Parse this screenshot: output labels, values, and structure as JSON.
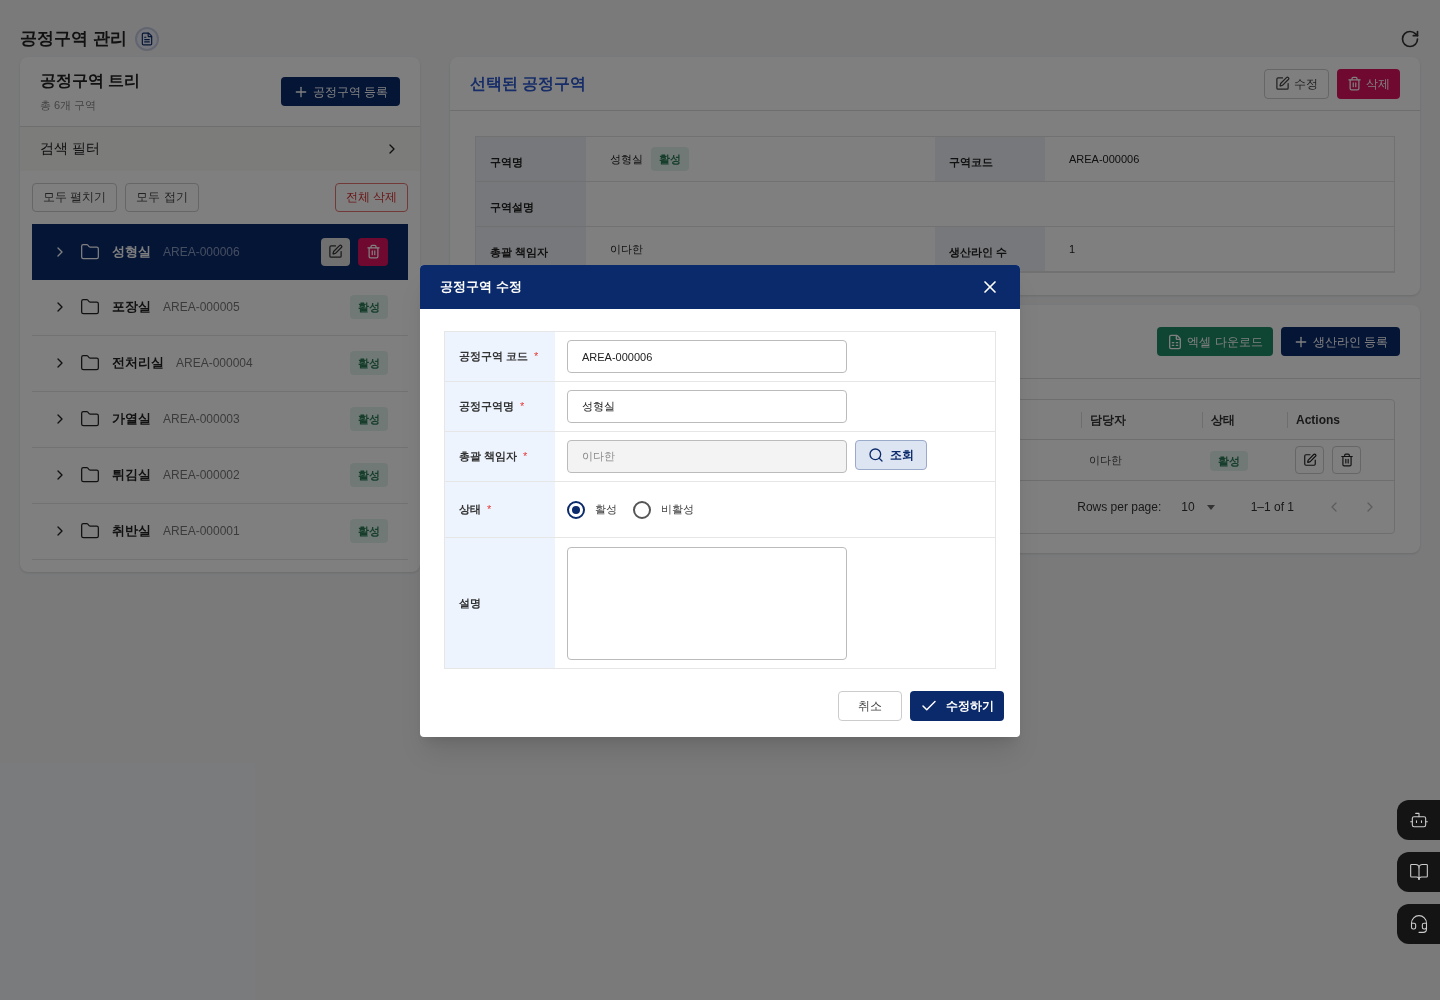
{
  "page": {
    "title": "공정구역 관리"
  },
  "tree_panel": {
    "title": "공정구역 트리",
    "count": "총 6개 구역",
    "register_button": "공정구역 등록",
    "filter_label": "검색 필터",
    "expand_all": "모두 펼치기",
    "collapse_all": "모두 접기",
    "delete_all": "전체 삭제",
    "items": [
      {
        "name": "성형실",
        "code": "AREA-000006",
        "selected": true
      },
      {
        "name": "포장실",
        "code": "AREA-000005",
        "status": "활성",
        "selected": false
      },
      {
        "name": "전처리실",
        "code": "AREA-000004",
        "status": "활성",
        "selected": false
      },
      {
        "name": "가열실",
        "code": "AREA-000003",
        "status": "활성",
        "selected": false
      },
      {
        "name": "튀김실",
        "code": "AREA-000002",
        "status": "활성",
        "selected": false
      },
      {
        "name": "취반실",
        "code": "AREA-000001",
        "status": "활성",
        "selected": false
      }
    ]
  },
  "detail_panel": {
    "title": "선택된 공정구역",
    "edit_button": "수정",
    "delete_button": "삭제",
    "rows": [
      [
        {
          "label": "구역명",
          "value": "성형실",
          "badge": "활성"
        },
        {
          "label": "구역코드",
          "value": "AREA-000006"
        }
      ],
      [
        {
          "label": "구역설명"
        }
      ],
      [
        {
          "label": "총괄 책임자",
          "value": "이다한"
        },
        {
          "label": "생산라인 수",
          "value": "1"
        }
      ]
    ]
  },
  "lines_panel": {
    "excel_button": "엑셀 다운로드",
    "register_button": "생산라인 등록",
    "columns": [
      "담당자",
      "상태",
      "Actions"
    ],
    "rows": [
      {
        "manager": "이다한",
        "status": "활성"
      }
    ],
    "pagination": {
      "rows_per_page_label": "Rows per page:",
      "rows_per_page": "10",
      "range": "1–1 of 1"
    }
  },
  "modal": {
    "title": "공정구역 수정",
    "fields": [
      {
        "kind": "text",
        "label": "공정구역 코드",
        "required_mark": "*",
        "value": "AREA-000006"
      },
      {
        "kind": "text",
        "label": "공정구역명",
        "required_mark": "*",
        "value": "성형실"
      },
      {
        "kind": "lookup",
        "label": "총괄 책임자",
        "required_mark": "*",
        "value": "이다한",
        "button": "조회"
      },
      {
        "kind": "radio",
        "label": "상태",
        "required_mark": "*",
        "options": [
          {
            "label": "활성",
            "selected": true
          },
          {
            "label": "비활성",
            "selected": false
          }
        ]
      },
      {
        "kind": "textarea",
        "label": "설명"
      }
    ],
    "cancel_button": "취소",
    "submit_button": "수정하기"
  }
}
